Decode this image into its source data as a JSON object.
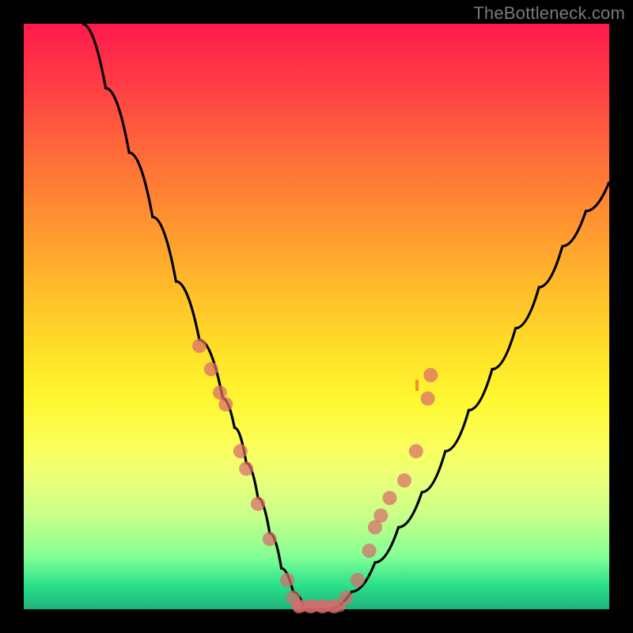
{
  "watermark": "TheBottleneck.com",
  "colors": {
    "curve": "#000000",
    "markers": "#d96b6b",
    "gradient_top": "#ff1a4d",
    "gradient_bottom": "#1fb27a"
  },
  "chart_data": {
    "type": "line",
    "title": "",
    "xlabel": "",
    "ylabel": "",
    "xlim": [
      0,
      100
    ],
    "ylim": [
      0,
      100
    ],
    "grid": false,
    "legend": false,
    "series": [
      {
        "name": "bottleneck-curve",
        "x": [
          10,
          14,
          18,
          22,
          26,
          30,
          34,
          36,
          38,
          40,
          42,
          44,
          46,
          48,
          52,
          56,
          60,
          64,
          68,
          72,
          76,
          80,
          84,
          88,
          92,
          96,
          100
        ],
        "y": [
          100,
          89,
          78,
          67,
          56,
          46,
          36,
          31,
          25,
          19,
          13,
          7,
          3,
          0,
          0,
          3,
          8,
          14,
          20,
          27,
          34,
          41,
          48,
          55,
          62,
          68,
          73
        ]
      }
    ],
    "markers": [
      {
        "x": 30.0,
        "y": 45
      },
      {
        "x": 32.0,
        "y": 41
      },
      {
        "x": 33.5,
        "y": 37
      },
      {
        "x": 34.5,
        "y": 35
      },
      {
        "x": 37.0,
        "y": 27
      },
      {
        "x": 38.0,
        "y": 24
      },
      {
        "x": 40.0,
        "y": 18
      },
      {
        "x": 42.0,
        "y": 12
      },
      {
        "x": 45.0,
        "y": 5
      },
      {
        "x": 46.0,
        "y": 2
      },
      {
        "x": 47.0,
        "y": 0.5
      },
      {
        "x": 49.0,
        "y": 0.5
      },
      {
        "x": 51.0,
        "y": 0.5
      },
      {
        "x": 53.0,
        "y": 0.5
      },
      {
        "x": 55.0,
        "y": 2
      },
      {
        "x": 57.0,
        "y": 5
      },
      {
        "x": 59.0,
        "y": 10
      },
      {
        "x": 60.0,
        "y": 14
      },
      {
        "x": 61.0,
        "y": 16
      },
      {
        "x": 62.5,
        "y": 19
      },
      {
        "x": 65.0,
        "y": 22
      },
      {
        "x": 67.0,
        "y": 27
      },
      {
        "x": 69.0,
        "y": 36
      },
      {
        "x": 69.5,
        "y": 40
      }
    ],
    "annotations": [
      {
        "text": "TheBottleneck.com",
        "x": 98,
        "y": 99,
        "anchor": "top-right"
      }
    ]
  }
}
